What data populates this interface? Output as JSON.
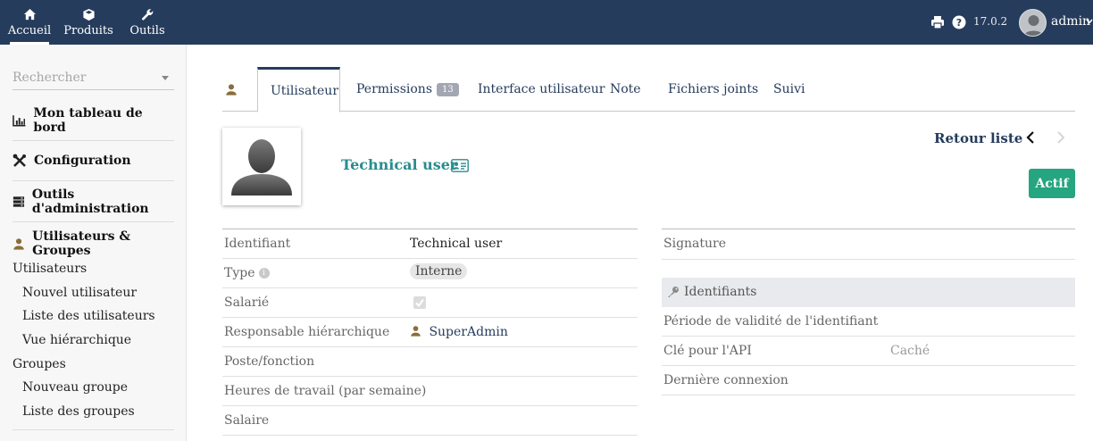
{
  "topbar": {
    "menu": [
      {
        "label": "Accueil",
        "icon": "home-icon"
      },
      {
        "label": "Produits",
        "icon": "cube-icon"
      },
      {
        "label": "Outils",
        "icon": "wrench-icon"
      }
    ],
    "version": "17.0.2",
    "user": "admin",
    "colors": {
      "bar": "#263c5c"
    }
  },
  "sidebar": {
    "search_placeholder": "Rechercher",
    "sections": [
      {
        "label": "Mon tableau de bord",
        "icon": "chart-icon"
      },
      {
        "label": "Configuration",
        "icon": "tools-icon"
      },
      {
        "label": "Outils d'administration",
        "icon": "server-icon"
      },
      {
        "label": "Utilisateurs & Groupes",
        "icon": "user-icon"
      }
    ],
    "items": [
      {
        "label": "Utilisateurs"
      },
      {
        "label": "Nouvel utilisateur"
      },
      {
        "label": "Liste des utilisateurs"
      },
      {
        "label": "Vue hiérarchique"
      },
      {
        "label": "Groupes"
      },
      {
        "label": "Nouveau groupe"
      },
      {
        "label": "Liste des groupes"
      }
    ]
  },
  "tabs": [
    {
      "label": "Utilisateur"
    },
    {
      "label": "Permissions",
      "badge": "13"
    },
    {
      "label": "Interface utilisateur"
    },
    {
      "label": "Note"
    },
    {
      "label": "Fichiers joints"
    },
    {
      "label": "Suivi"
    }
  ],
  "profile": {
    "name": "Technical user",
    "back_label": "Retour liste",
    "status": "Actif",
    "status_color": "#25a580"
  },
  "fields_left": [
    {
      "label": "Identifiant",
      "value": "Technical user"
    },
    {
      "label": "Type",
      "value": "Interne"
    },
    {
      "label": "Salarié",
      "value": ""
    },
    {
      "label": "Responsable hiérarchique",
      "value": "SuperAdmin"
    },
    {
      "label": "Poste/fonction",
      "value": ""
    },
    {
      "label": "Heures de travail (par semaine)",
      "value": ""
    },
    {
      "label": "Salaire",
      "value": ""
    }
  ],
  "fields_right": {
    "signature_label": "Signature",
    "section_title": "Identifiants",
    "rows": [
      {
        "label": "Période de validité de l'identifiant",
        "value": ""
      },
      {
        "label": "Clé pour l'API",
        "value": "Caché"
      },
      {
        "label": "Dernière connexion",
        "value": ""
      }
    ]
  }
}
